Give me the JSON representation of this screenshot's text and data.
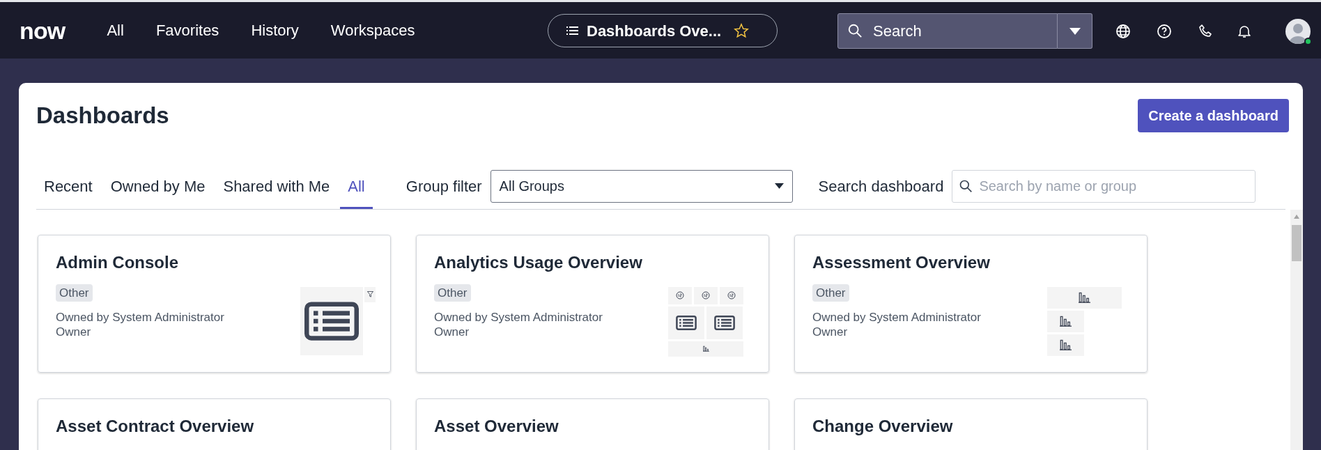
{
  "top_nav": {
    "logo": "now",
    "links": [
      {
        "label": "All"
      },
      {
        "label": "Favorites"
      },
      {
        "label": "History"
      },
      {
        "label": "Workspaces"
      }
    ],
    "context_pill": {
      "title": "Dashboards Ove...",
      "favorite": false
    },
    "search": {
      "placeholder": "Search"
    },
    "user": {
      "online": true
    }
  },
  "page": {
    "title": "Dashboards",
    "create_button": "Create a dashboard",
    "tabs": [
      {
        "label": "Recent",
        "selected": false
      },
      {
        "label": "Owned by Me",
        "selected": false
      },
      {
        "label": "Shared with Me",
        "selected": false
      },
      {
        "label": "All",
        "selected": true
      }
    ],
    "group_filter": {
      "label": "Group filter",
      "value": "All Groups"
    },
    "search_dashboard": {
      "label": "Search dashboard",
      "placeholder": "Search by name or group"
    },
    "cards": [
      {
        "title": "Admin Console",
        "tag": "Other",
        "owner": "Owned by System Administrator",
        "role": "Owner",
        "kind": "list"
      },
      {
        "title": "Analytics Usage Overview",
        "tag": "Other",
        "owner": "Owned by System Administrator",
        "role": "Owner",
        "kind": "grid"
      },
      {
        "title": "Assessment Overview",
        "tag": "Other",
        "owner": "Owned by System Administrator",
        "role": "Owner",
        "kind": "bars"
      },
      {
        "title": "Asset Contract Overview"
      },
      {
        "title": "Asset Overview"
      },
      {
        "title": "Change Overview"
      }
    ]
  }
}
